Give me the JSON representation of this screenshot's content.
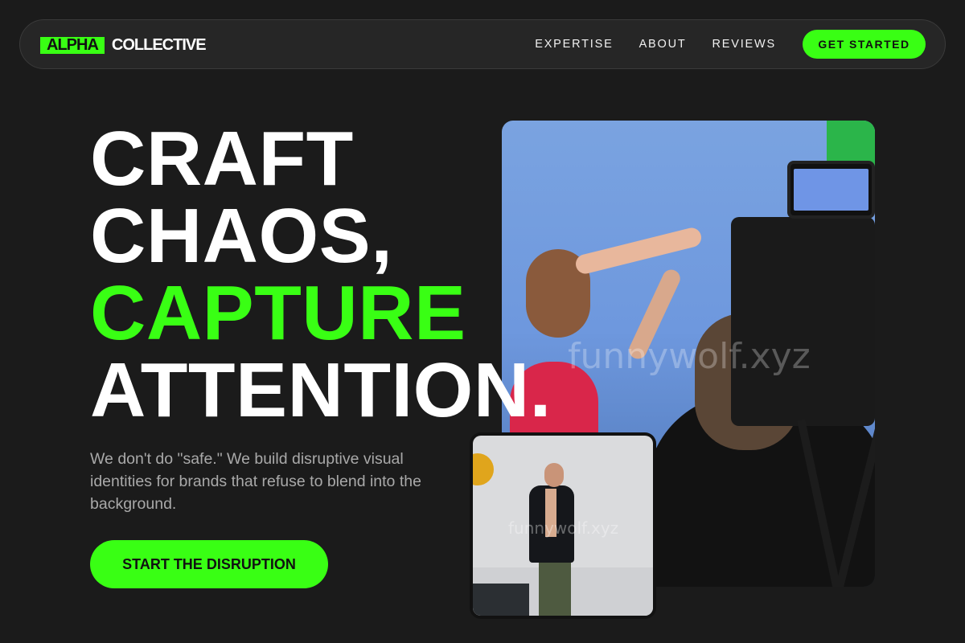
{
  "brand": {
    "mark": "ALPHA",
    "word": "COLLECTIVE",
    "accent_color": "#39ff14"
  },
  "nav": {
    "links": [
      "EXPERTISE",
      "ABOUT",
      "REVIEWS"
    ],
    "cta_label": "GET STARTED"
  },
  "hero": {
    "lines": [
      "CRAFT",
      "CHAOS,",
      "CAPTURE",
      "ATTENTION."
    ],
    "subtitle": "We don't do \"safe.\" We build disruptive visual identities for brands that refuse to blend into the background.",
    "cta_label": "START THE DISRUPTION"
  },
  "watermark": "funnywolf.xyz"
}
